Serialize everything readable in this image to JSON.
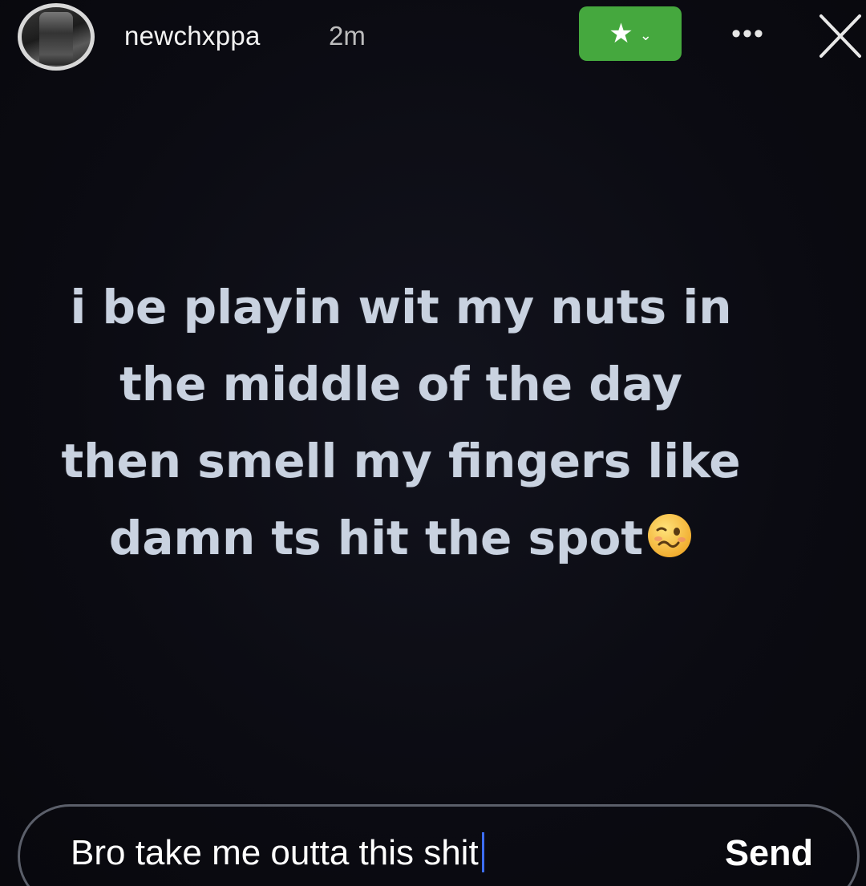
{
  "header": {
    "username": "newchxppa",
    "time": "2m",
    "close_friends_icon": "star-icon",
    "close_friends_chevron": "chevron-down-icon",
    "more_label": "•••",
    "close_icon": "close-icon"
  },
  "story": {
    "text": "i be playin wit my nuts in the middle of the day then smell my fingers like damn ts hit the spot",
    "emoji": "woozy-face-emoji"
  },
  "reply": {
    "value": "Bro take me outta this shit",
    "send_label": "Send"
  },
  "colors": {
    "background": "#0b0b12",
    "story_text": "#c9d2e0",
    "close_friends_green": "#45a83e",
    "caret_blue": "#3d6df5"
  }
}
